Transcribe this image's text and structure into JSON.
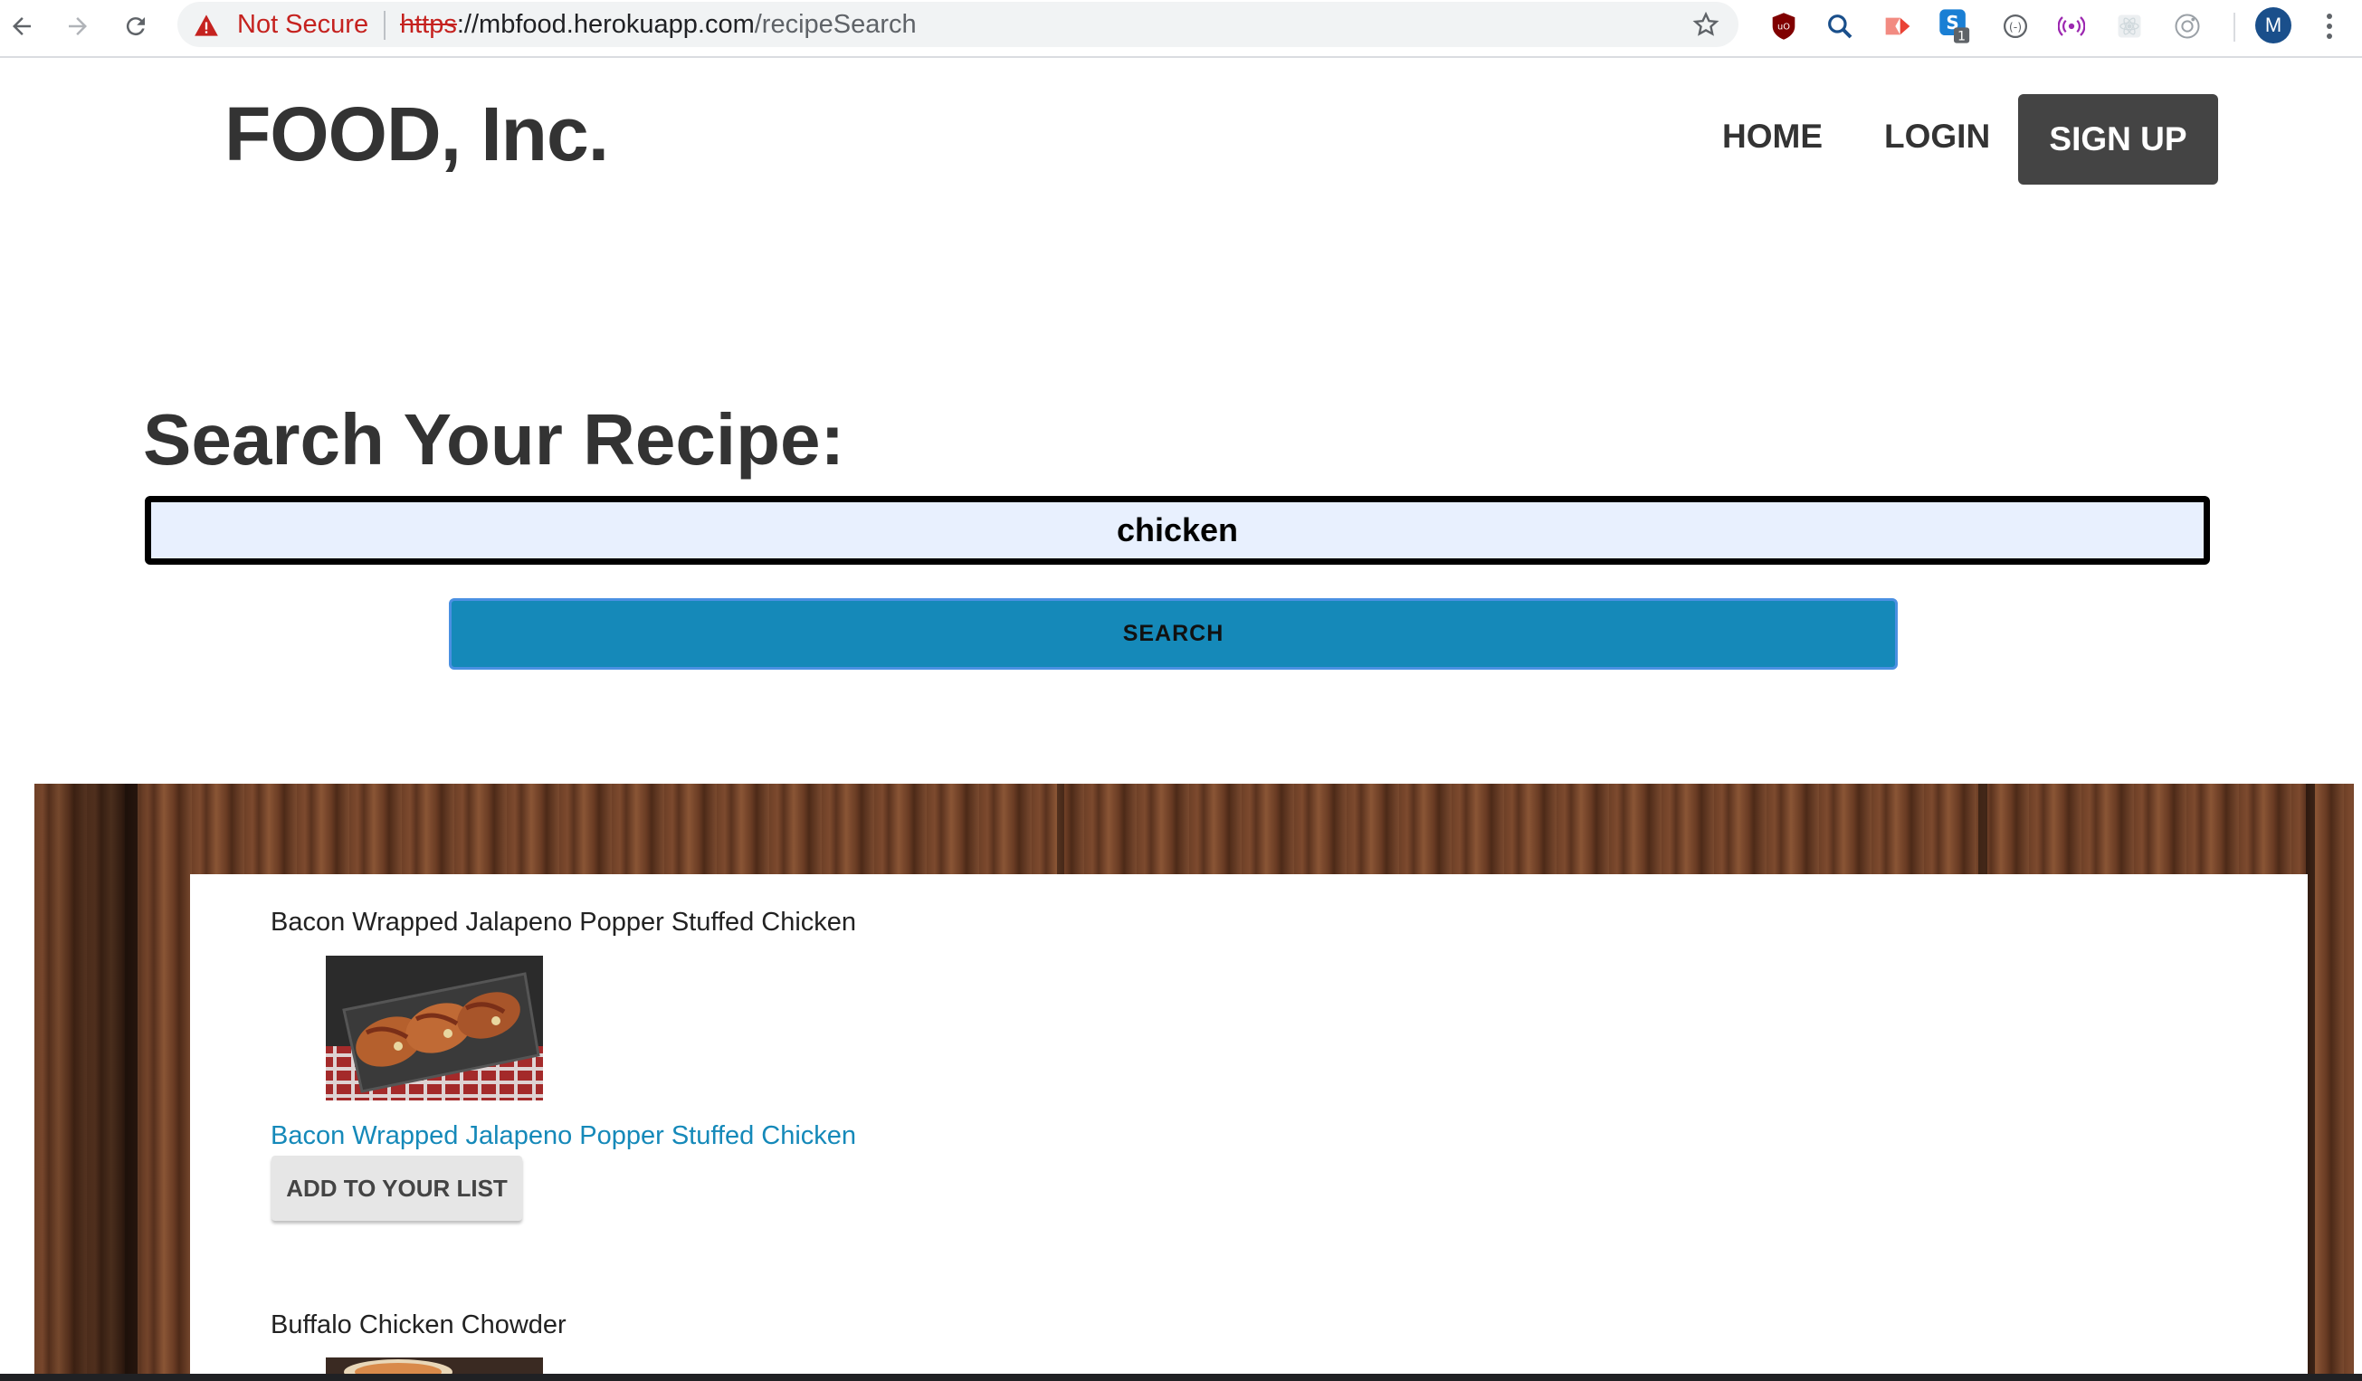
{
  "browser": {
    "security_label": "Not Secure",
    "url_scheme": "https",
    "url_sep": "://",
    "url_host": "mbfood.herokuapp.com",
    "url_path": "/recipeSearch",
    "avatar_letter": "M",
    "extension_badge": "1"
  },
  "header": {
    "brand": "FOOD, Inc.",
    "nav": {
      "home": "HOME",
      "login": "LOGIN",
      "signup": "SIGN UP"
    }
  },
  "search": {
    "title": "Search Your Recipe:",
    "query": "chicken",
    "button_label": "SEARCH"
  },
  "results": [
    {
      "title": "Bacon Wrapped Jalapeno Popper Stuffed Chicken",
      "link": "Bacon Wrapped Jalapeno Popper Stuffed Chicken",
      "add_label": "ADD TO YOUR LIST"
    },
    {
      "title": "Buffalo Chicken Chowder"
    }
  ],
  "colors": {
    "accent": "#1589b9",
    "brand_text": "#333333",
    "signup_bg": "#444444",
    "warning_red": "#c5221f"
  }
}
